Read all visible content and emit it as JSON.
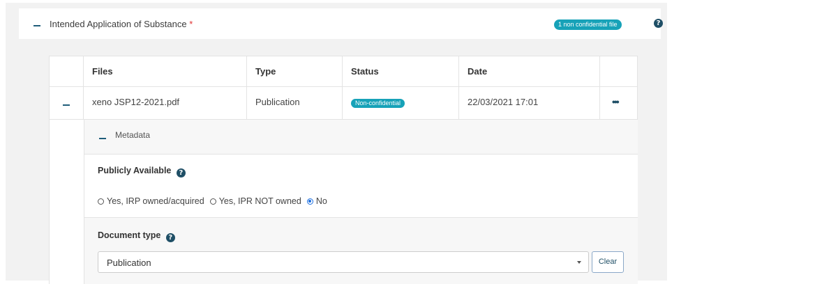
{
  "panel": {
    "title": "Intended Application of Substance",
    "required_mark": "*",
    "files_badge": "1 non confidential file"
  },
  "table": {
    "headers": [
      "Files",
      "Type",
      "Status",
      "Date"
    ],
    "rows": [
      {
        "file": "xeno JSP12-2021.pdf",
        "type": "Publication",
        "status": "Non-confidential",
        "date": "22/03/2021 17:01"
      }
    ]
  },
  "metadata": {
    "title": "Metadata",
    "publicly_available": {
      "label": "Publicly Available",
      "options": [
        "Yes, IRP owned/acquired",
        "Yes, IPR NOT owned",
        "No"
      ],
      "selected": "No"
    },
    "document_type": {
      "label": "Document type",
      "value": "Publication",
      "clear_label": "Clear"
    }
  },
  "icons": {
    "help": "question-circle-icon",
    "more": "ellipsis-icon",
    "collapse": "minus-icon",
    "caret": "caret-down-icon"
  },
  "colors": {
    "accent": "#17a2b8",
    "dark": "#1f4f66",
    "radio_selected": "#1d6fe0",
    "required": "#e03131"
  }
}
